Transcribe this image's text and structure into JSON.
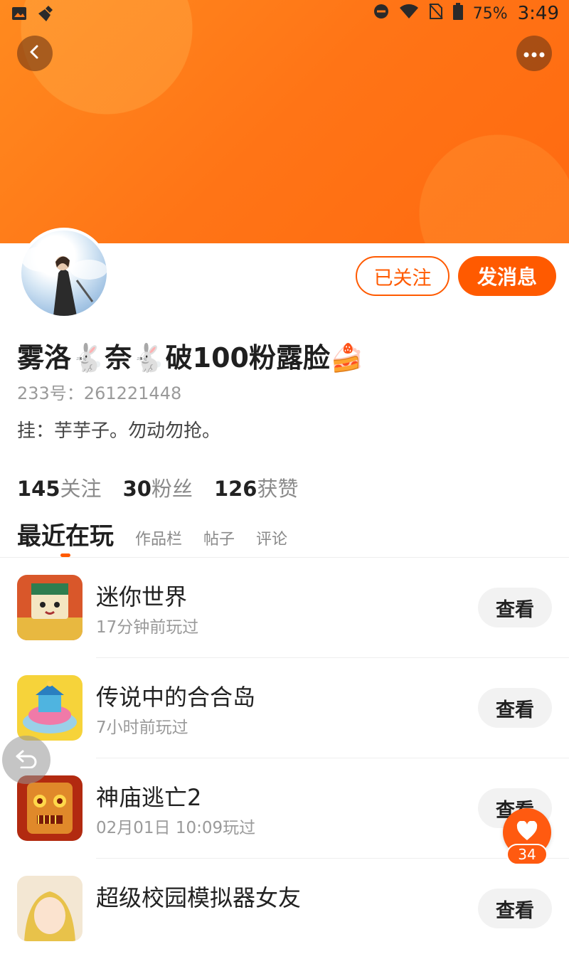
{
  "status_bar": {
    "battery": "75%",
    "time": "3:49"
  },
  "header": {
    "back_icon": "chevron-left-icon",
    "more_icon": "more-dots-icon"
  },
  "profile": {
    "name": "雾洛🐇奈🐇破100粉露脸🍰",
    "id_text": "233号：261221448",
    "bio": "挂：芋芋子。勿动勿抢。",
    "follow_button": "已关注",
    "message_button": "发消息"
  },
  "stats": [
    {
      "num": "145",
      "label": "关注"
    },
    {
      "num": "30",
      "label": "粉丝"
    },
    {
      "num": "126",
      "label": "获赞"
    }
  ],
  "tabs": {
    "active": "最近在玩",
    "items": [
      "作品栏",
      "帖子",
      "评论"
    ]
  },
  "games": [
    {
      "title": "迷你世界",
      "subtitle": "17分钟前玩过",
      "button": "查看"
    },
    {
      "title": "传说中的合合岛",
      "subtitle": "7小时前玩过",
      "button": "查看"
    },
    {
      "title": "神庙逃亡2",
      "subtitle": "02月01日 10:09玩过",
      "button": "查看"
    },
    {
      "title": "超级校园模拟器女友",
      "subtitle": "",
      "button": "查看"
    }
  ],
  "floating": {
    "like_count": "34"
  },
  "colors": {
    "accent": "#ff5a00",
    "banner": "#ff7416"
  }
}
